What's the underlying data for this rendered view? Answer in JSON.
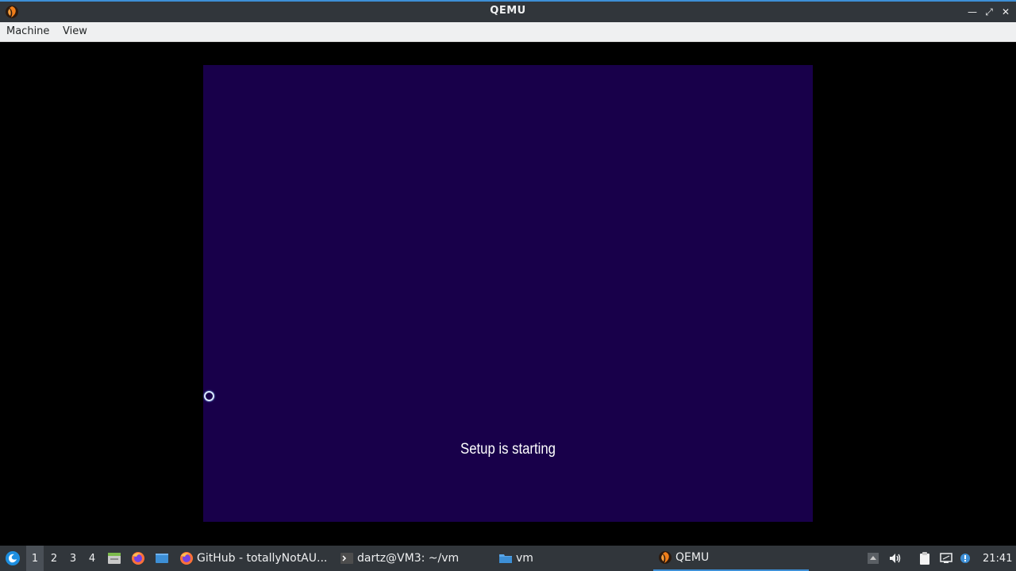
{
  "window": {
    "title": "QEMU",
    "minimize_icon": "minimize-icon",
    "maximize_icon": "maximize-icon",
    "close_icon": "close-icon"
  },
  "menu": {
    "items": [
      "Machine",
      "View"
    ]
  },
  "guest": {
    "status_text": "Setup is starting",
    "background_color": "#18004a"
  },
  "taskbar": {
    "workspaces": [
      "1",
      "2",
      "3",
      "4"
    ],
    "launchers": [
      "start-menu-icon",
      "file-manager-icon",
      "firefox-icon",
      "desktop-icon"
    ],
    "tasks": [
      {
        "label": "GitHub - totallyNotAU...",
        "icon": "firefox-icon"
      },
      {
        "label": "dartz@VM3: ~/vm",
        "icon": "terminal-icon"
      },
      {
        "label": "vm",
        "icon": "folder-icon"
      },
      {
        "label": "QEMU",
        "icon": "qemu-icon"
      }
    ],
    "tray_icons": [
      "tray-up-arrow-icon",
      "volume-icon",
      "clipboard-icon",
      "network-icon",
      "update-notification-icon"
    ],
    "clock": "21:41"
  }
}
